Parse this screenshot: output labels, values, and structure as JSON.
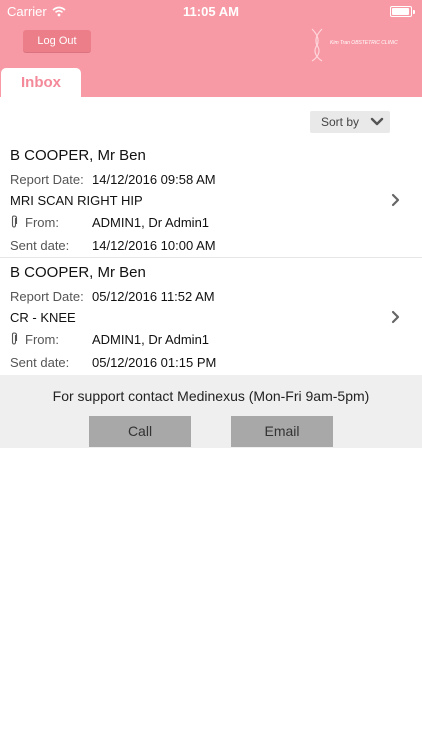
{
  "status_bar": {
    "carrier": "Carrier",
    "time": "11:05 AM"
  },
  "header": {
    "logout_label": "Log Out",
    "logo_text": "Kim Tran OBSTETRIC CLINIC",
    "tab_label": "Inbox",
    "background": "#f79aa5",
    "accent": "#f4899a"
  },
  "sort": {
    "label": "Sort by"
  },
  "reports": [
    {
      "patient": "B COOPER, Mr Ben",
      "report_date_label": "Report Date:",
      "report_date": "14/12/2016 09:58 AM",
      "study": "MRI SCAN RIGHT HIP",
      "from_label": "From:",
      "from": "ADMIN1, Dr Admin1",
      "sent_date_label": "Sent date:",
      "sent_date": "14/12/2016 10:00 AM"
    },
    {
      "patient": "B COOPER, Mr Ben",
      "report_date_label": "Report Date:",
      "report_date": "05/12/2016 11:52 AM",
      "study": "CR - KNEE",
      "from_label": "From:",
      "from": "ADMIN1, Dr Admin1",
      "sent_date_label": "Sent date:",
      "sent_date": "05/12/2016 01:15 PM"
    }
  ],
  "support": {
    "text": "For support contact Medinexus (Mon-Fri 9am-5pm)",
    "call_label": "Call",
    "email_label": "Email"
  }
}
